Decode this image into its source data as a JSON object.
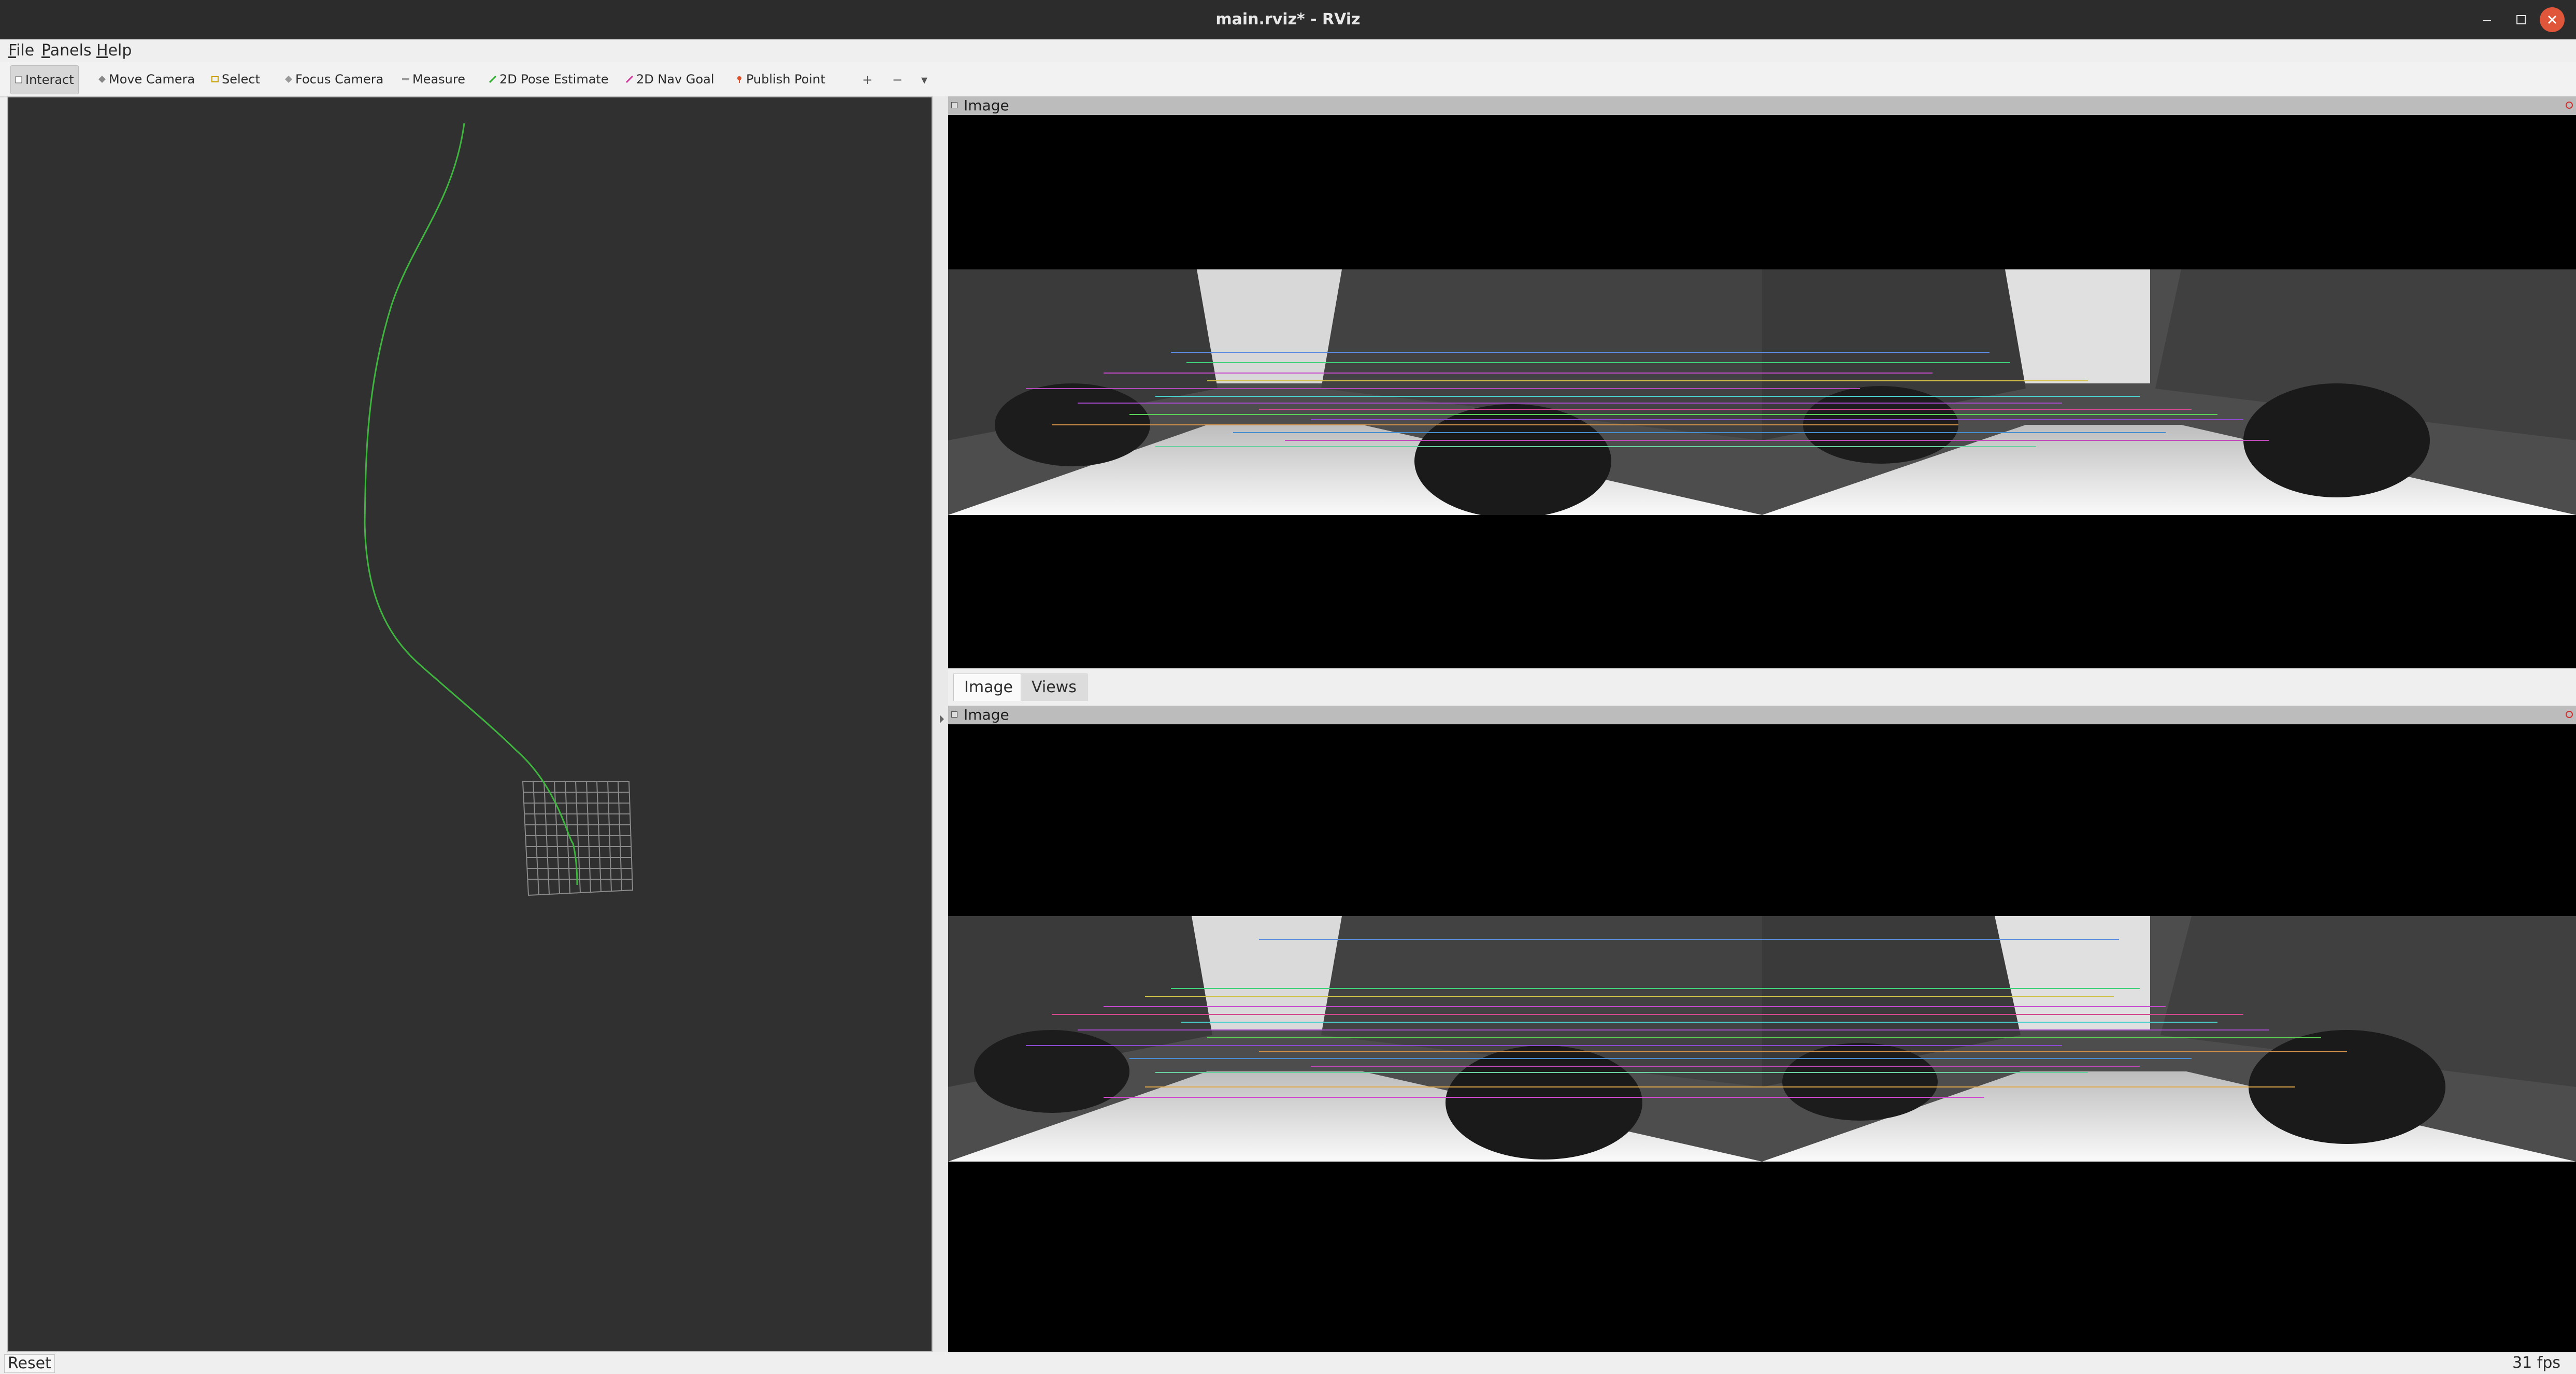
{
  "window": {
    "title": "main.rviz* - RViz"
  },
  "menu": [
    {
      "accel": "F",
      "rest": "ile"
    },
    {
      "accel": "P",
      "rest": "anels"
    },
    {
      "accel": "H",
      "rest": "elp"
    }
  ],
  "toolbar": {
    "tools": [
      {
        "label": "Interact",
        "icon": "interact-icon",
        "active": true
      },
      {
        "label": "Move Camera",
        "icon": "move-camera-icon"
      },
      {
        "label": "Select",
        "icon": "select-icon"
      },
      {
        "label": "Focus Camera",
        "icon": "focus-camera-icon"
      },
      {
        "label": "Measure",
        "icon": "measure-icon"
      },
      {
        "label": "2D Pose Estimate",
        "icon": "pose-estimate-icon"
      },
      {
        "label": "2D Nav Goal",
        "icon": "nav-goal-icon"
      },
      {
        "label": "Publish Point",
        "icon": "publish-point-icon"
      }
    ],
    "extra_icons": [
      "add-tool-icon",
      "remove-tool-icon",
      "tool-properties-icon"
    ]
  },
  "view3d": {
    "background": "#303030",
    "trajectory_color": "#3fb53f",
    "grid_color": "#8a8a8a"
  },
  "panels": {
    "top": {
      "title": "Image"
    },
    "bottom": {
      "title": "Image"
    }
  },
  "tabs": [
    "Image",
    "Views"
  ],
  "statusbar": {
    "reset": "Reset",
    "fps": "31 fps"
  },
  "colors": {
    "titlebar": "#2c2c2c",
    "close_button": "#e0563a",
    "panel_header": "#bcbcbc"
  }
}
